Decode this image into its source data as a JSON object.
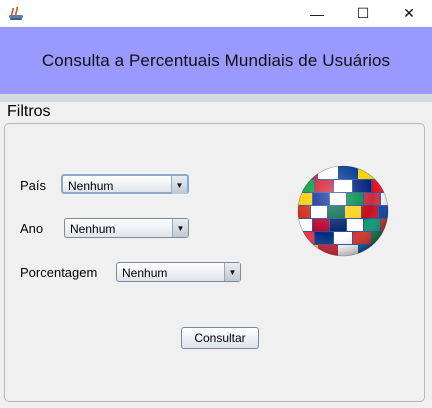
{
  "window": {
    "minimize_glyph": "—",
    "maximize_glyph": "☐",
    "close_glyph": "✕"
  },
  "header": {
    "title": "Consulta a Percentuais Mundiais de Usuários",
    "background": "#9999ff"
  },
  "filters": {
    "section_title": "Filtros",
    "pais": {
      "label": "País",
      "value": "Nenhum"
    },
    "ano": {
      "label": "Ano",
      "value": "Nenhum"
    },
    "porcentagem": {
      "label": "Porcentagem",
      "value": "Nenhum"
    },
    "submit_label": "Consultar"
  },
  "icons": {
    "app": "java-app-icon",
    "globe": "world-flags-globe-icon"
  }
}
